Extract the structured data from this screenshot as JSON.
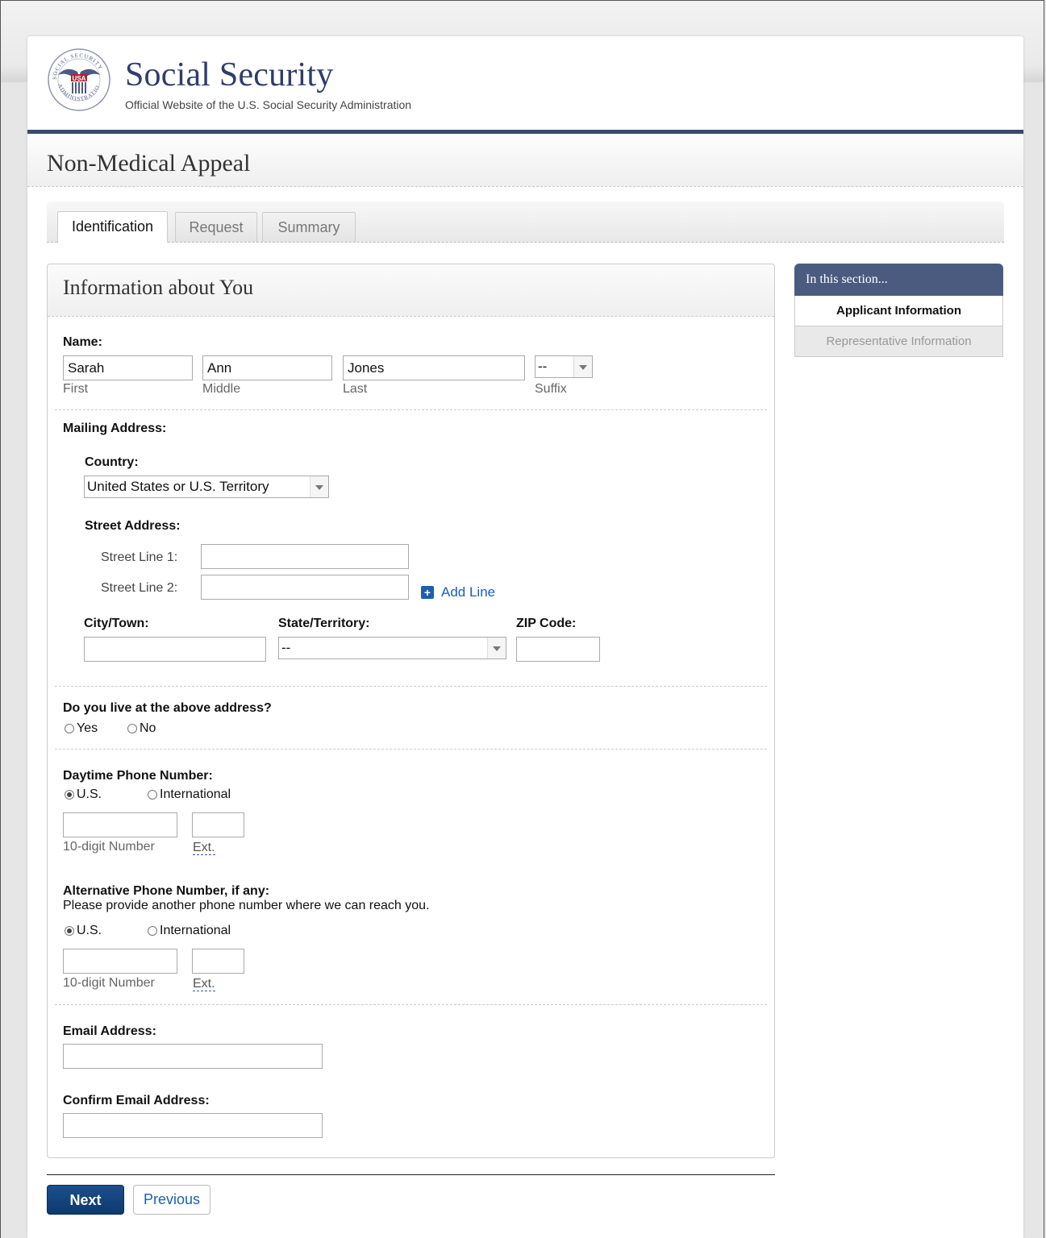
{
  "header": {
    "brand_title": "Social Security",
    "brand_subtitle": "Official Website of the U.S. Social Security Administration",
    "seal_label": "USA"
  },
  "page_title": "Non-Medical Appeal",
  "tabs": [
    {
      "label": "Identification",
      "active": true
    },
    {
      "label": "Request",
      "active": false
    },
    {
      "label": "Summary",
      "active": false
    }
  ],
  "panel_title": "Information about You",
  "name": {
    "label": "Name:",
    "first_value": "Sarah",
    "first_caption": "First",
    "middle_value": "Ann",
    "middle_caption": "Middle",
    "last_value": "Jones",
    "last_caption": "Last",
    "suffix_value": "--",
    "suffix_caption": "Suffix"
  },
  "mailing": {
    "label": "Mailing Address:",
    "country_label": "Country:",
    "country_value": "United States or U.S. Territory",
    "street_label": "Street Address:",
    "line1_label": "Street Line 1:",
    "line2_label": "Street Line 2:",
    "add_line": "Add Line",
    "city_label": "City/Town:",
    "state_label": "State/Territory:",
    "state_value": "--",
    "zip_label": "ZIP Code:"
  },
  "live_at_address": {
    "question": "Do you live at the above address?",
    "yes": "Yes",
    "no": "No"
  },
  "daytime_phone": {
    "label": "Daytime Phone Number:",
    "us": "U.S.",
    "intl": "International",
    "number_caption": "10-digit Number",
    "ext_caption": "Ext."
  },
  "alt_phone": {
    "label": "Alternative Phone Number, if any:",
    "help": "Please provide another phone number where we can reach you.",
    "us": "U.S.",
    "intl": "International",
    "number_caption": "10-digit Number",
    "ext_caption": "Ext."
  },
  "email": {
    "label": "Email Address:",
    "confirm_label": "Confirm Email Address:"
  },
  "sidebar": {
    "heading": "In this section...",
    "items": [
      {
        "label": "Applicant Information",
        "active": true
      },
      {
        "label": "Representative Information",
        "active": false
      }
    ]
  },
  "buttons": {
    "next": "Next",
    "previous": "Previous"
  },
  "colors": {
    "brand_navy": "#2f3d6b",
    "header_rule": "#3a4a6b",
    "sidebar_head": "#4b5b80",
    "link_blue": "#1a5fb4",
    "next_button": "#0d3a6e"
  }
}
